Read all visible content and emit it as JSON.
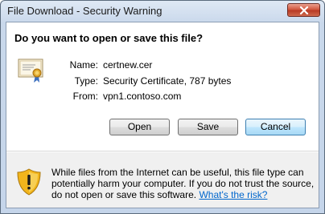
{
  "window": {
    "title": "File Download - Security Warning"
  },
  "dialog": {
    "question": "Do you want to open or save this file?",
    "file_info": [
      {
        "label": "Name:",
        "value": "certnew.cer"
      },
      {
        "label": "Type:",
        "value": "Security Certificate, 787 bytes"
      },
      {
        "label": "From:",
        "value": "vpn1.contoso.com"
      }
    ],
    "buttons": {
      "open": "Open",
      "save": "Save",
      "cancel": "Cancel"
    },
    "warning": {
      "text": "While files from the Internet can be useful, this file type can potentially harm your computer. If you do not trust the source, do not open or save this software. ",
      "link": "What's the risk?"
    }
  },
  "icons": {
    "close": "close-icon",
    "file": "certificate-icon",
    "warning": "warning-shield-icon"
  },
  "colors": {
    "link": "#0066cc",
    "default_button_border": "#3c7fb1",
    "close_button": "#c24a33"
  }
}
